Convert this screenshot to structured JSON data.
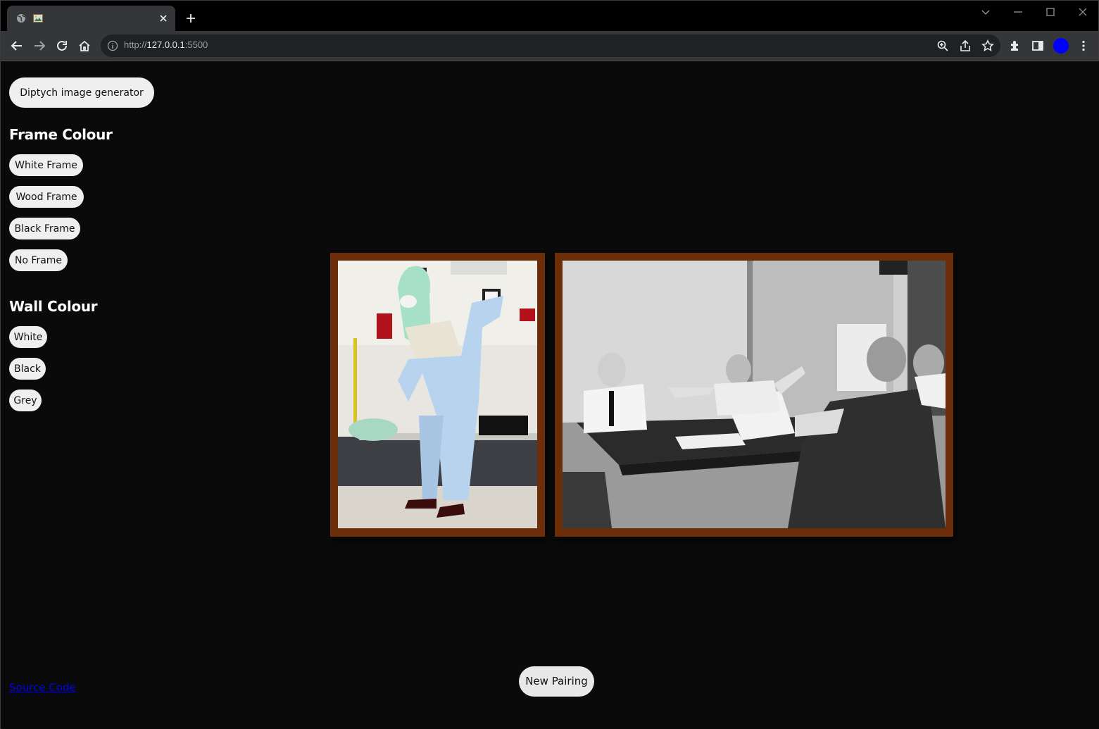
{
  "browser": {
    "url_scheme": "http://",
    "url_host": "127.0.0.1",
    "url_port": ":5500",
    "avatar_color": "#0000ff"
  },
  "sidebar": {
    "title_button": "Diptych image generator",
    "frame_heading": "Frame Colour",
    "frame_options": [
      "White Frame",
      "Wood Frame",
      "Black Frame",
      "No Frame"
    ],
    "wall_heading": "Wall Colour",
    "wall_options": [
      "White",
      "Black",
      "Grey"
    ],
    "source_link": "Source Code"
  },
  "diptych": {
    "frame_color": "#6b2e08",
    "wall_color": "#0a0a0a",
    "left_image": "person-putting-on-cleanroom-suit-photo",
    "right_image": "vintage-meeting-room-black-and-white-photo"
  },
  "actions": {
    "new_pairing": "New Pairing"
  }
}
